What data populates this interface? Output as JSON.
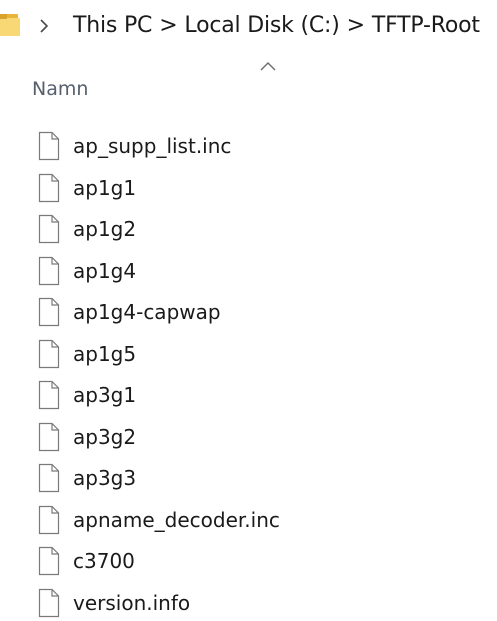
{
  "address_bar": {
    "icon": "folder-icon",
    "separator": ">",
    "crumbs": [
      "This PC",
      "Local Disk (C:)",
      "TFTP-Root"
    ]
  },
  "columns": {
    "name_header": "Namn",
    "sort_indicator": "sort-ascending-icon"
  },
  "files": [
    {
      "name": "ap_supp_list.inc",
      "icon": "file-icon"
    },
    {
      "name": "ap1g1",
      "icon": "file-icon"
    },
    {
      "name": "ap1g2",
      "icon": "file-icon"
    },
    {
      "name": "ap1g4",
      "icon": "file-icon"
    },
    {
      "name": "ap1g4-capwap",
      "icon": "file-icon"
    },
    {
      "name": "ap1g5",
      "icon": "file-icon"
    },
    {
      "name": "ap3g1",
      "icon": "file-icon"
    },
    {
      "name": "ap3g2",
      "icon": "file-icon"
    },
    {
      "name": "ap3g3",
      "icon": "file-icon"
    },
    {
      "name": "apname_decoder.inc",
      "icon": "file-icon"
    },
    {
      "name": "c3700",
      "icon": "file-icon"
    },
    {
      "name": "version.info",
      "icon": "file-icon"
    }
  ]
}
